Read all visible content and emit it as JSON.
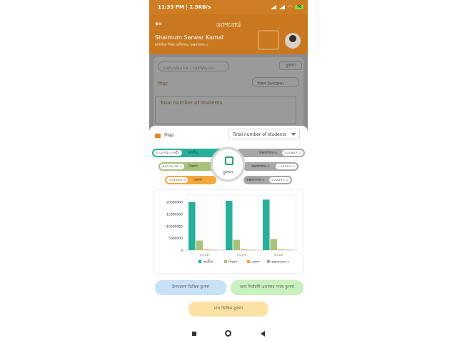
{
  "status_bar": {
    "time_network": "11:35 PM | 1.5KB/s",
    "battery": "76"
  },
  "header": {
    "title": "ড্যাশবোর্ড",
    "user_name": "Shaimum Sarwar Kamal",
    "user_role": "মাধ্যমিক শিক্ষা অফিসার, কক্সবাজার-৩"
  },
  "background": {
    "date_range": "০১/০১/২০১৬ - ১৫/৩/২০২০",
    "compare_label": "তুলনা",
    "section": "শিক্ষা",
    "upazila_select": "সকল উপজেলা",
    "total_label": "Total number of students"
  },
  "sheet": {
    "section_title": "শিক্ষা",
    "metric_select": "Total number of students",
    "compare_center_label": "তুলনা",
    "rows": [
      {
        "left_value": "২.০৮৭৫০১৬E৭",
        "left_label": "জাতীয়",
        "right_label": "কক্সবাজার-৩",
        "right_value": "১০৫৪৪৭.০"
      },
      {
        "left_value": "৫৪১২৮৭৪.০",
        "left_label": "বিভাগ",
        "right_label": "কক্সবাজার-৩",
        "right_value": "১০৫৪৪৭.০"
      },
      {
        "left_value": "৩০৫৪৪৬.০",
        "left_label": "জেলা",
        "right_label": "কক্সবাজার-৩",
        "right_value": "১০৫৪৪৭.০"
      }
    ],
    "buttons": {
      "upazila_compare": "উপজেলা ভিত্তিক তুলনা",
      "other_compare": "অন্য নির্বাচনী এলাকার সাথে তুলনা",
      "month_compare": "মাস ভিত্তিক তুলনা"
    }
  },
  "colors": {
    "national": "#26b09a",
    "division": "#a8c27a",
    "district": "#f3a83b",
    "area": "#a7a7a7",
    "header": "#cf7d22"
  },
  "chart_data": {
    "type": "bar",
    "categories": [
      "২০১৬",
      "২০১৭",
      "২০১৮"
    ],
    "series": [
      {
        "name": "জাতীয়",
        "values": [
          20000000,
          20500000,
          21000000
        ]
      },
      {
        "name": "বিভাগ",
        "values": [
          4000000,
          4300000,
          4600000
        ]
      },
      {
        "name": "জেলা",
        "values": [
          300000,
          300000,
          300000
        ]
      },
      {
        "name": "কক্সবাজার-৩",
        "values": [
          100000,
          100000,
          100000
        ]
      }
    ],
    "y_ticks": [
      "0",
      "5000000",
      "10000000",
      "15000000",
      "20000000"
    ],
    "ylim": [
      0,
      22000000
    ],
    "legend_position": "bottom"
  }
}
